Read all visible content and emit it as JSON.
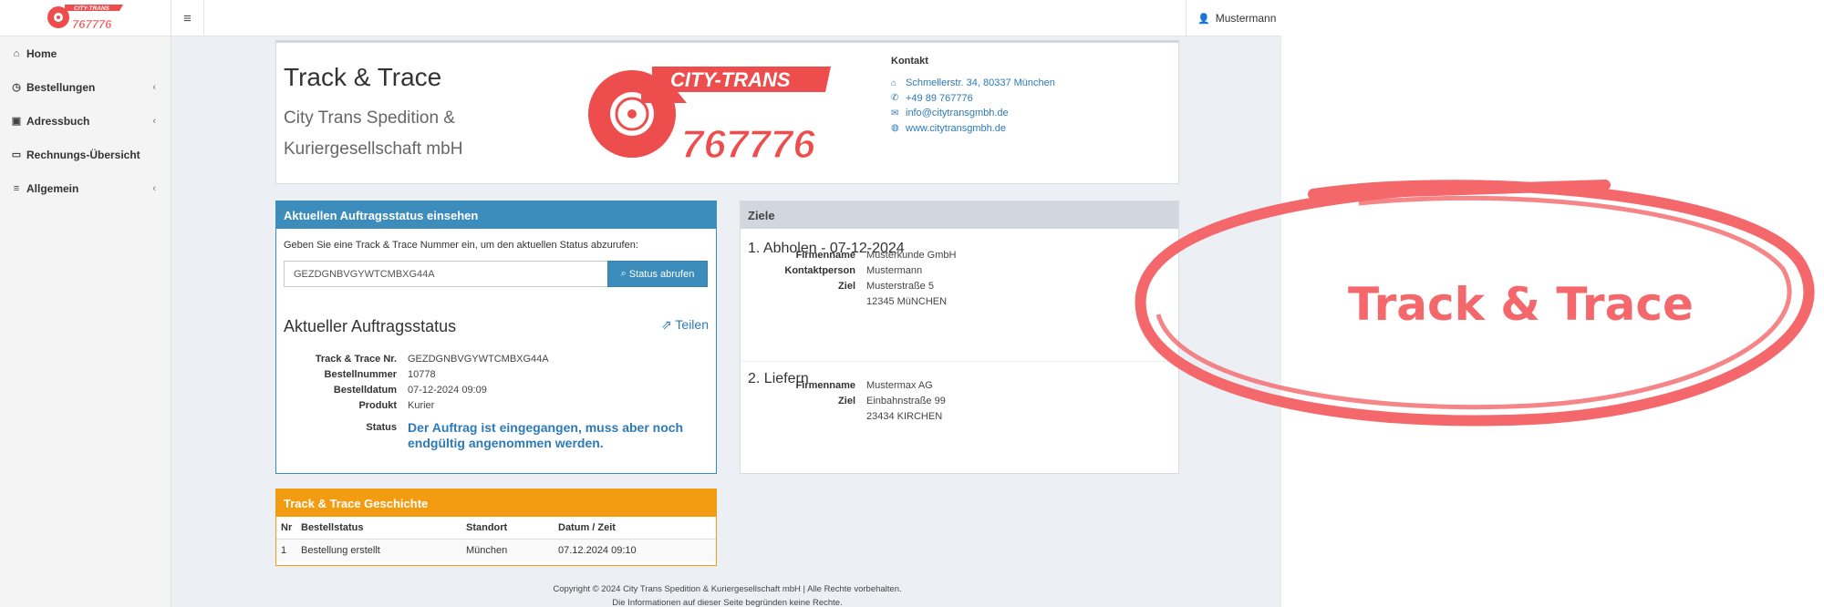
{
  "app": {
    "logo_text": "CITY-TRANS",
    "logo_number": "767776",
    "user_name": "Mustermann"
  },
  "sidebar": {
    "items": [
      {
        "label": "Home",
        "icon": "home-icon",
        "has_children": false
      },
      {
        "label": "Bestellungen",
        "icon": "clock-icon",
        "has_children": true
      },
      {
        "label": "Adressbuch",
        "icon": "address-book-icon",
        "has_children": true
      },
      {
        "label": "Rechnungs-Übersicht",
        "icon": "credit-card-icon",
        "has_children": false
      },
      {
        "label": "Allgemein",
        "icon": "list-icon",
        "has_children": true
      }
    ]
  },
  "header": {
    "title": "Track & Trace",
    "subtitle": "City Trans Spedition & Kuriergesellschaft mbH",
    "contact_title": "Kontakt",
    "contact": {
      "address": "Schmellerstr. 34, 80337 München",
      "phone": "+49 89 767776",
      "email": "info@citytransgmbh.de",
      "website": "www.citytransgmbh.de"
    }
  },
  "status_panel": {
    "title": "Aktuellen Auftragsstatus einsehen",
    "hint": "Geben Sie eine Track & Trace Nummer ein, um den aktuellen Status abzurufen:",
    "input_value": "GEZDGNBVGYWTCMBXG44A",
    "button_label": "Status abrufen",
    "subtitle": "Aktueller Auftragsstatus",
    "share_label": "Teilen",
    "details": [
      {
        "label": "Track & Trace Nr.",
        "value": "GEZDGNBVGYWTCMBXG44A"
      },
      {
        "label": "Bestellnummer",
        "value": "10778"
      },
      {
        "label": "Bestelldatum",
        "value": "07-12-2024 09:09"
      },
      {
        "label": "Produkt",
        "value": "Kurier"
      }
    ],
    "status_label": "Status",
    "status_value": "Der Auftrag ist eingegangen, muss aber noch endgültig angenommen werden."
  },
  "ziele_panel": {
    "title": "Ziele",
    "stops": [
      {
        "heading": "1. Abholen - 07-12-2024",
        "rows": [
          {
            "label": "Firmenname",
            "value": "Musterkunde GmbH"
          },
          {
            "label": "Kontaktperson",
            "value": "Mustermann"
          },
          {
            "label": "Ziel",
            "value": "Musterstraße 5"
          },
          {
            "label": "",
            "value": "12345 MüNCHEN"
          }
        ]
      },
      {
        "heading": "2. Liefern",
        "rows": [
          {
            "label": "Firmenname",
            "value": "Mustermax AG"
          },
          {
            "label": "Ziel",
            "value": "Einbahnstraße 99"
          },
          {
            "label": "",
            "value": "23434 KIRCHEN"
          }
        ]
      }
    ]
  },
  "history_panel": {
    "title": "Track & Trace Geschichte",
    "columns": [
      "Nr",
      "Bestellstatus",
      "Standort",
      "Datum / Zeit"
    ],
    "rows": [
      {
        "nr": "1",
        "status": "Bestellung erstellt",
        "location": "München",
        "datetime": "07.12.2024 09:10"
      }
    ]
  },
  "footer": {
    "line1": "Copyright © 2024 City Trans Spedition & Kuriergesellschaft mbH | Alle Rechte vorbehalten.",
    "line2": "Die Informationen auf dieser Seite begründen keine Rechte."
  },
  "annotation": {
    "text": "Track & Trace",
    "color": "#f4676a"
  },
  "colors": {
    "primary": "#3c8dbc",
    "warning": "#f39c12",
    "brand_red": "#ee4d4d",
    "link": "#2c7ab8"
  }
}
